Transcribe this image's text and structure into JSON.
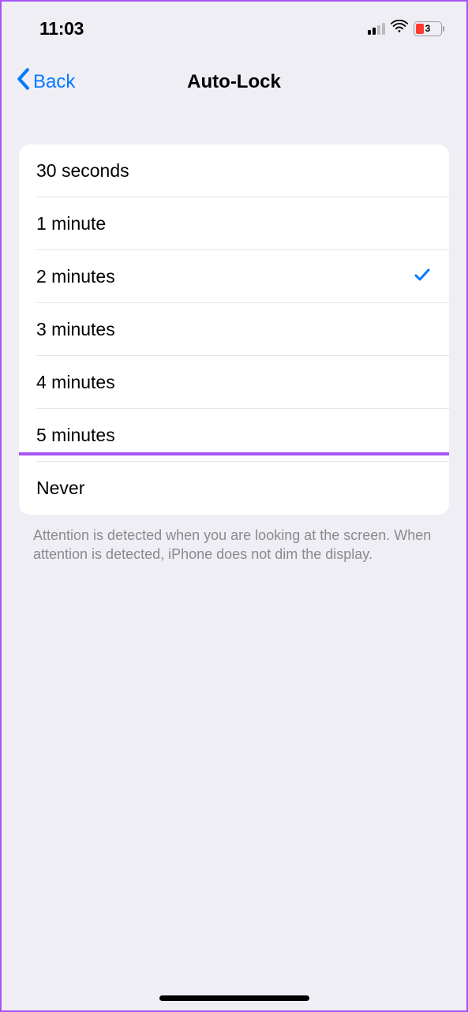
{
  "status": {
    "time": "11:03",
    "battery_level": "3"
  },
  "nav": {
    "back_label": "Back",
    "title": "Auto-Lock"
  },
  "options": [
    {
      "label": "30 seconds",
      "selected": false
    },
    {
      "label": "1 minute",
      "selected": false
    },
    {
      "label": "2 minutes",
      "selected": true
    },
    {
      "label": "3 minutes",
      "selected": false
    },
    {
      "label": "4 minutes",
      "selected": false
    },
    {
      "label": "5 minutes",
      "selected": false
    },
    {
      "label": "Never",
      "selected": false
    }
  ],
  "footer": "Attention is detected when you are looking at the screen. When attention is detected, iPhone does not dim the display."
}
